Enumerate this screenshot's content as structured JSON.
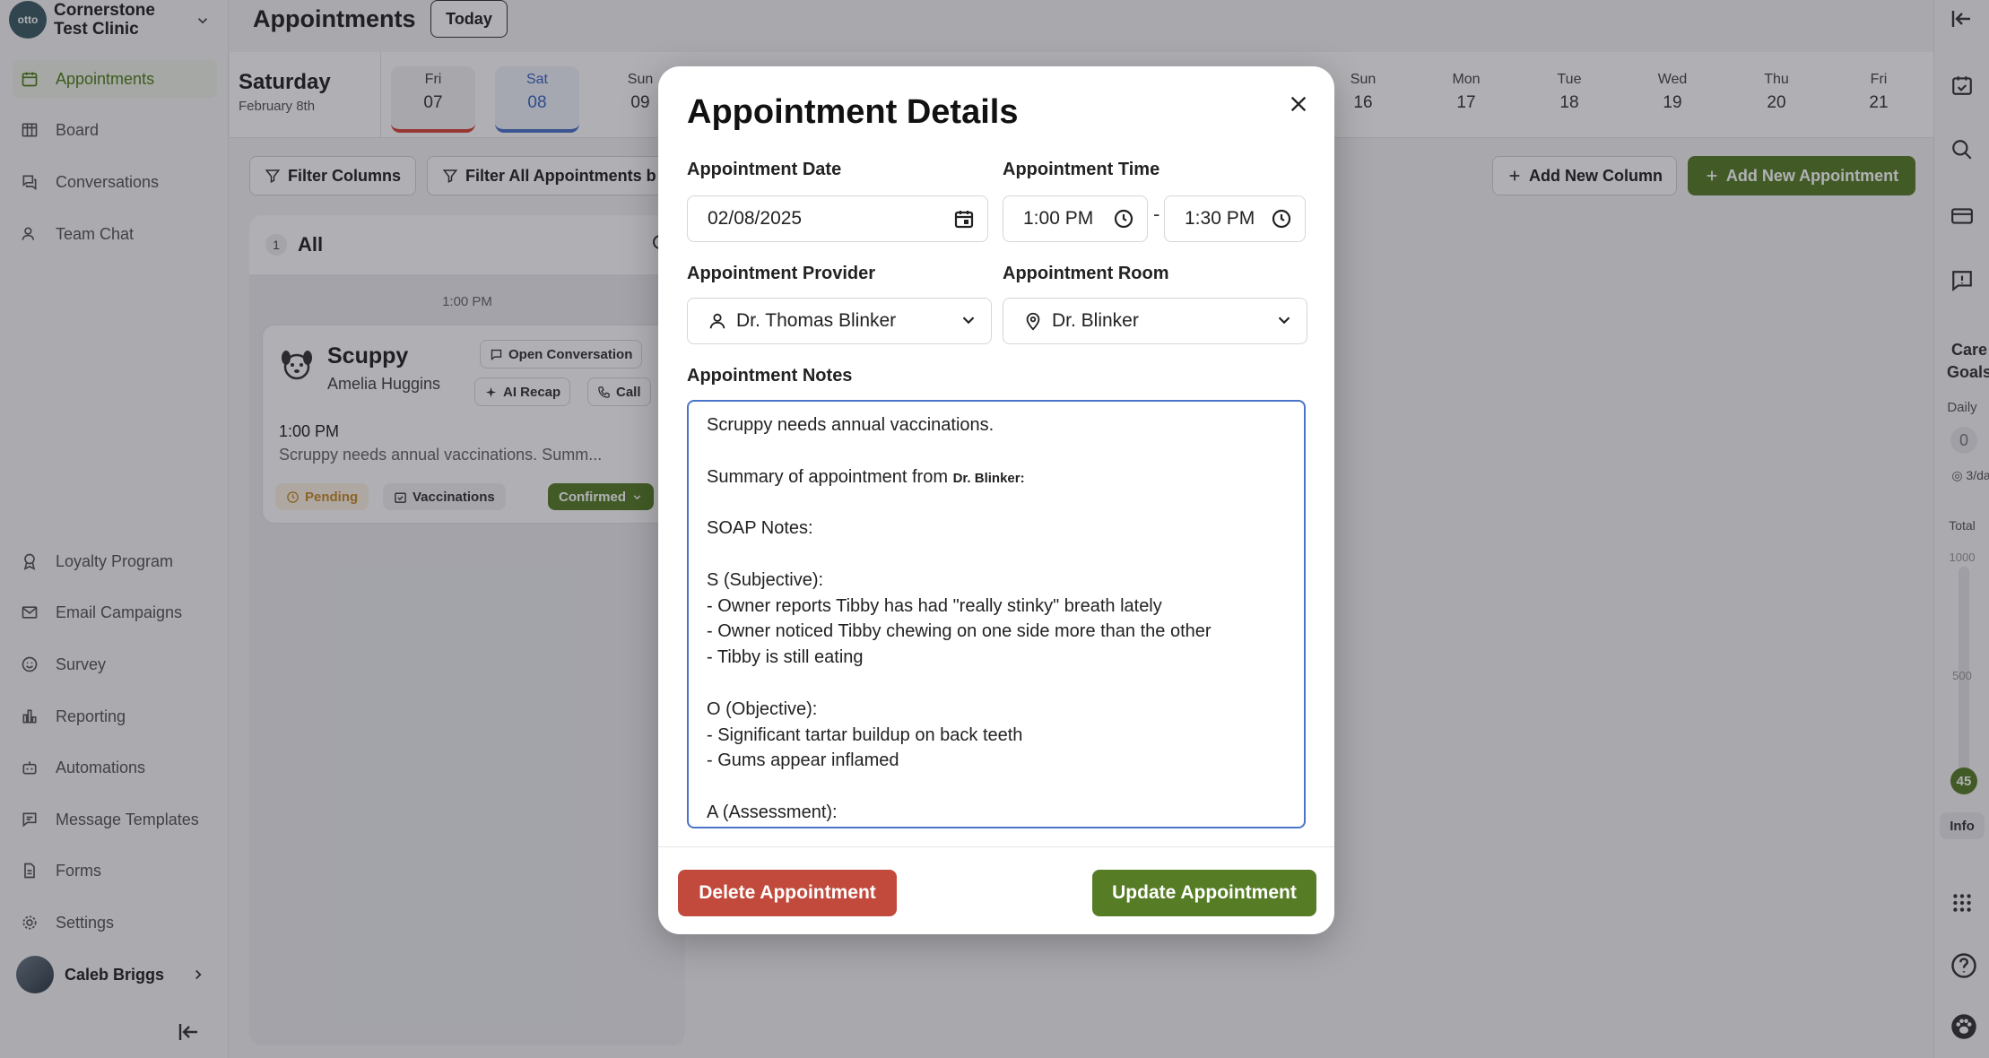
{
  "clinic": {
    "logo_text": "otto",
    "name_line1": "Cornerstone",
    "name_line2": "Test Clinic"
  },
  "sidebar": {
    "items": [
      {
        "label": "Appointments",
        "icon": "calendar-icon"
      },
      {
        "label": "Board",
        "icon": "board-icon"
      },
      {
        "label": "Conversations",
        "icon": "chat-icon"
      },
      {
        "label": "Team Chat",
        "icon": "people-icon"
      },
      {
        "label": "Loyalty Program",
        "icon": "award-icon"
      },
      {
        "label": "Email Campaigns",
        "icon": "mail-icon"
      },
      {
        "label": "Survey",
        "icon": "smile-icon"
      },
      {
        "label": "Reporting",
        "icon": "bar-chart-icon"
      },
      {
        "label": "Automations",
        "icon": "robot-icon"
      },
      {
        "label": "Message Templates",
        "icon": "message-icon"
      },
      {
        "label": "Forms",
        "icon": "document-icon"
      },
      {
        "label": "Settings",
        "icon": "gear-icon"
      }
    ],
    "user_name": "Caleb Briggs"
  },
  "header": {
    "title": "Appointments",
    "today_label": "Today"
  },
  "date_strip": {
    "selected_day": "Saturday",
    "selected_date": "February 8th",
    "days": [
      {
        "name": "Fri",
        "num": "07"
      },
      {
        "name": "Sat",
        "num": "08"
      },
      {
        "name": "Sun",
        "num": "09"
      },
      {
        "name": "Sun",
        "num": "16"
      },
      {
        "name": "Mon",
        "num": "17"
      },
      {
        "name": "Tue",
        "num": "18"
      },
      {
        "name": "Wed",
        "num": "19"
      },
      {
        "name": "Thu",
        "num": "20"
      },
      {
        "name": "Fri",
        "num": "21"
      }
    ]
  },
  "toolbar": {
    "filter_columns": "Filter Columns",
    "filter_all": "Filter All Appointments b",
    "add_column": "Add New Column",
    "add_appointment": "Add New Appointment"
  },
  "column": {
    "count": "1",
    "title": "All",
    "time_mark": "1:00 PM",
    "card": {
      "pet": "Scuppy",
      "owner": "Amelia Huggins",
      "open_conversation": "Open Conversation",
      "ai_recap": "AI Recap",
      "call": "Call",
      "time": "1:00 PM",
      "note": "Scruppy needs annual vaccinations. Summ...",
      "status_pending": "Pending",
      "tag_vaccinations": "Vaccinations",
      "status_confirmed": "Confirmed"
    }
  },
  "rail": {
    "care_goals_line1": "Care",
    "care_goals_line2": "Goals",
    "daily": "Daily",
    "daily_value": "0",
    "per_day": "3/da",
    "total": "Total",
    "tick_1000": "1000",
    "tick_500": "500",
    "total_value": "45",
    "info": "Info"
  },
  "modal": {
    "title": "Appointment Details",
    "date_label": "Appointment Date",
    "date_value": "02/08/2025",
    "time_label": "Appointment Time",
    "time_start": "1:00 PM",
    "time_end": "1:30 PM",
    "time_sep": "-",
    "provider_label": "Appointment Provider",
    "provider_value": "Dr. Thomas Blinker",
    "room_label": "Appointment Room",
    "room_value": "Dr. Blinker",
    "notes_label": "Appointment Notes",
    "notes": {
      "l1": "Scruppy needs annual vaccinations.",
      "l3a": "Summary of appointment from ",
      "l3b": "Dr. Blinker:",
      "l5": "SOAP Notes:",
      "l7": "S (Subjective):",
      "l8": "- Owner reports Tibby has had \"really stinky\" breath lately",
      "l9": "- Owner noticed Tibby chewing on one side more than the other",
      "l10": "- Tibby is still eating",
      "l12": "O (Objective):",
      "l13": "- Significant tartar buildup on back teeth",
      "l14": "- Gums appear inflamed",
      "l16": "A (Assessment):"
    },
    "delete_label": "Delete Appointment",
    "update_label": "Update Appointment"
  },
  "colors": {
    "accent_green": "#567d26",
    "danger_red": "#c24a3d",
    "focus_blue": "#4a74c9"
  }
}
